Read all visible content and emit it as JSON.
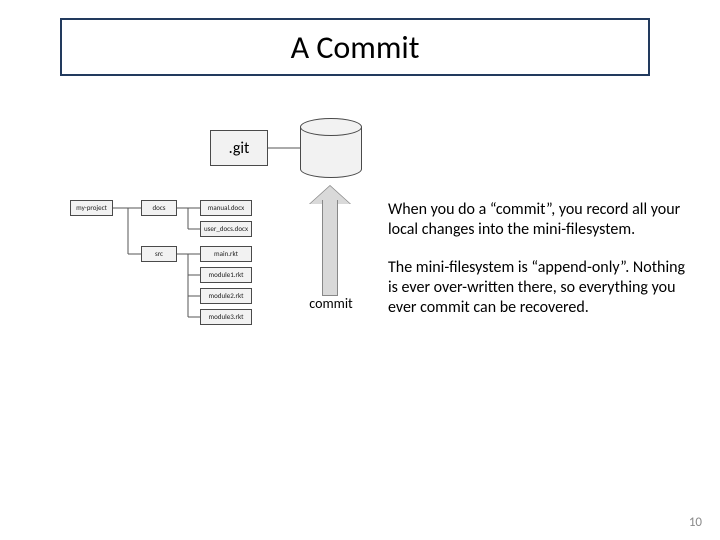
{
  "title": "A Commit",
  "git_label": ".git",
  "tree": {
    "root": "my-project",
    "docs": "docs",
    "manual": "manual.docx",
    "user_docs": "user_docs.docx",
    "src": "src",
    "main": "main.rkt",
    "module1": "module1.rkt",
    "module2": "module2.rkt",
    "module3": "module3.rkt"
  },
  "commit_label": "commit",
  "paragraphs": {
    "p1": "When you do a “commit”, you record all your local changes into the mini-filesystem.",
    "p2": "The mini-filesystem is “append-only”. Nothing is ever over-written there, so everything you ever commit can be recovered."
  },
  "slide_number": "10"
}
